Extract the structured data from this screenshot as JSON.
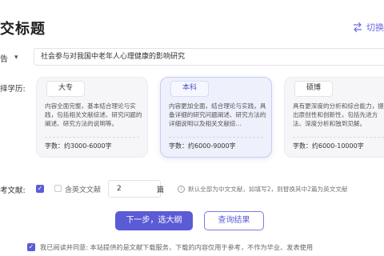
{
  "header": {
    "title": "交标题",
    "switch_label": "切换"
  },
  "paper_type": {
    "selected": "告",
    "topic_value": "社会参与对我国中老年人心理健康的影响研究"
  },
  "degree": {
    "label": "择学历:",
    "cards": [
      {
        "name": "大专",
        "desc": "内容全面完整，基本结合理论与实践，包括相关文献综述、研究问题的阐述、研究方法的说明等。",
        "count": "字数：约3000-6000字",
        "selected": false
      },
      {
        "name": "本科",
        "desc": "内容更加全面，结合理论与实践，具备详细的研究问题阐述、研究方法的详细说明以及相关文献综...",
        "count": "字数：约6000-9000字",
        "selected": true
      },
      {
        "name": "硕博",
        "desc": "具有更深度的分析和综合能力，提出原创性和创新性，包括先进方法、深度分析和独到见解。",
        "count": "字数：约6000-10000字",
        "selected": false
      }
    ]
  },
  "references": {
    "label": "考文献:",
    "english_label": "含英文文献",
    "english_count": "2",
    "unit": "篇",
    "hint": "默认全部为中文文献，如填写2，则替换其中2篇为英文文献"
  },
  "actions": {
    "next_label": "下一步，选大纲",
    "query_label": "查询结果"
  },
  "agreement": {
    "text": "我已阅读并同意: 本站提供的是文献下载服务，下载的内容仅用于参考，不作为毕业、发表使用"
  },
  "colors": {
    "accent": "#5b5bd6",
    "selected_card_bg": "#eef0fb"
  },
  "icons": {
    "switch": "swap-arrows-icon",
    "dropdown": "chevron-down-icon",
    "reference_check": "checkbox-checked-icon",
    "english_check": "checkbox-unchecked-icon",
    "hint": "info-icon",
    "agreement_check": "checkbox-checked-icon"
  }
}
